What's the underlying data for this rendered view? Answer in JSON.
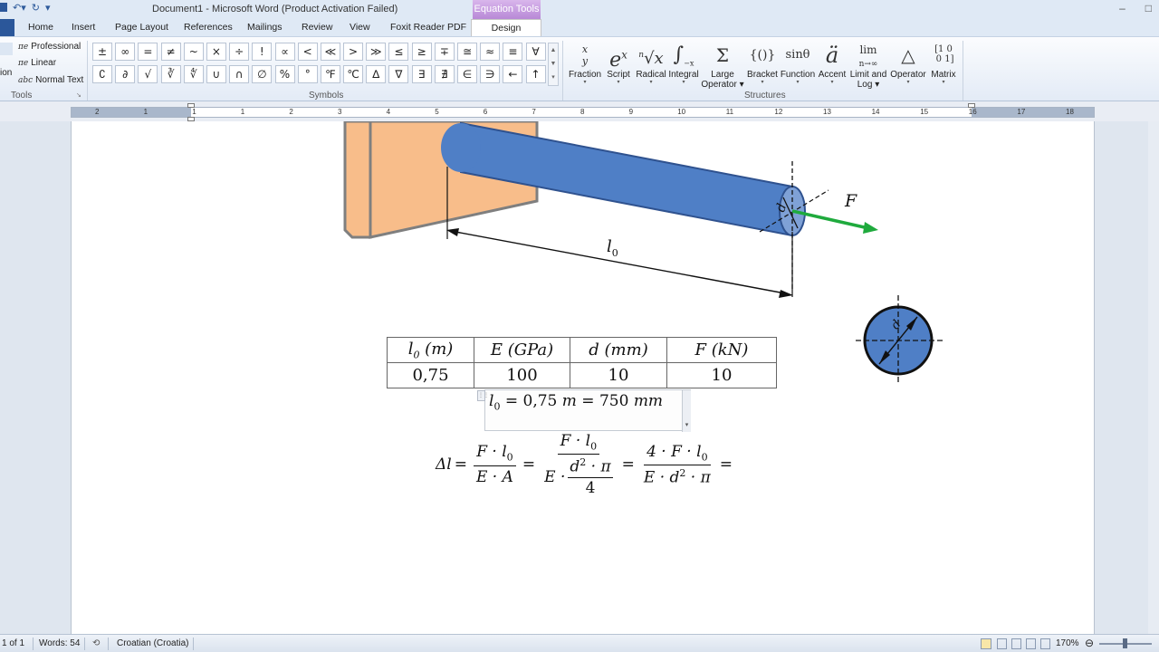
{
  "title": {
    "document": "Document1  -  Microsoft Word (Product Activation Failed)",
    "context_tab": "Equation Tools"
  },
  "tabs": [
    "Home",
    "Insert",
    "Page Layout",
    "References",
    "Mailings",
    "Review",
    "View",
    "Foxit Reader PDF"
  ],
  "active_tab": "Design",
  "tools": {
    "items": [
      "Professional",
      "Linear",
      "Normal Text"
    ],
    "label": "Tools",
    "cut_label": "ion",
    "icons": [
      "πe",
      "πe",
      "abc"
    ]
  },
  "symbols": {
    "row1": [
      "±",
      "∞",
      "=",
      "≠",
      "~",
      "×",
      "÷",
      "!",
      "∝",
      "<",
      "≪",
      ">",
      "≫",
      "≤",
      "≥",
      "∓",
      "≅",
      "≈",
      "≡",
      "∀"
    ],
    "row2": [
      "∁",
      "∂",
      "√",
      "∛",
      "∜",
      "∪",
      "∩",
      "∅",
      "%",
      "°",
      "℉",
      "℃",
      "∆",
      "∇",
      "∃",
      "∄",
      "∈",
      "∋",
      "←",
      "↑"
    ],
    "label": "Symbols"
  },
  "structures": {
    "items": [
      {
        "glyph": "x/y",
        "label": "Fraction"
      },
      {
        "glyph": "eˣ",
        "label": "Script"
      },
      {
        "glyph": "ⁿ√x",
        "label": "Radical"
      },
      {
        "glyph": "∫",
        "label": "Integral"
      },
      {
        "glyph": "Σ",
        "label": "Large Operator"
      },
      {
        "glyph": "{()}",
        "label": "Bracket"
      },
      {
        "glyph": "sinθ",
        "label": "Function"
      },
      {
        "glyph": "ä",
        "label": "Accent"
      },
      {
        "glyph": "lim",
        "label": "Limit and Log"
      },
      {
        "glyph": "△",
        "label": "Operator"
      },
      {
        "glyph": "[10]",
        "label": "Matrix"
      }
    ],
    "label": "Structures"
  },
  "ruler": {
    "numbers": [
      "2",
      "1",
      "1",
      "1",
      "2",
      "3",
      "4",
      "5",
      "6",
      "7",
      "8",
      "9",
      "10",
      "11",
      "12",
      "13",
      "14",
      "15",
      "16",
      "17",
      "18"
    ]
  },
  "drawing": {
    "labels": {
      "length": "l",
      "length_sub": "0",
      "force": "F",
      "diameter": "d"
    },
    "colors": {
      "wall": "#f8bd8a",
      "wall_edge": "#7f7f7f",
      "beam": "#4f7fc6",
      "beam_edge": "#2f528f",
      "force_arrow": "#1faa3d"
    }
  },
  "table": {
    "headers": [
      {
        "sym": "l",
        "sub": "0",
        "unit": " (m)"
      },
      {
        "sym": "E",
        "sub": "",
        "unit": " (GPa)"
      },
      {
        "sym": "d",
        "sub": "",
        "unit": " (mm)"
      },
      {
        "sym": "F",
        "sub": "",
        "unit": " (kN)"
      }
    ],
    "values": [
      "0,75",
      "100",
      "10",
      "10"
    ]
  },
  "equation1": {
    "lhs": "l",
    "lhs_sub": "0",
    "rhs1_num": "0,75",
    "rhs1_unit": "m",
    "rhs2_num": "750",
    "rhs2_unit": "mm"
  },
  "equation2": {
    "lhs": "Δl",
    "f1_num": "F · l",
    "f1_num_sub": "0",
    "f1_den": "E · A",
    "f2_num": "F · l",
    "f2_num_sub": "0",
    "f2_den_pre": "E ·",
    "f2_den_num": "d",
    "f2_den_num_sup": "2",
    "f2_den_num_post": " · π",
    "f2_den_den": "4",
    "f3_num": "4 · F · l",
    "f3_num_sub": "0",
    "f3_den": "E · d",
    "f3_den_sup": "2",
    "f3_den_post": " · π",
    "eq": "="
  },
  "status": {
    "page": "1 of 1",
    "words": "Words: 54",
    "language": "Croatian (Croatia)",
    "zoom": "170%"
  }
}
